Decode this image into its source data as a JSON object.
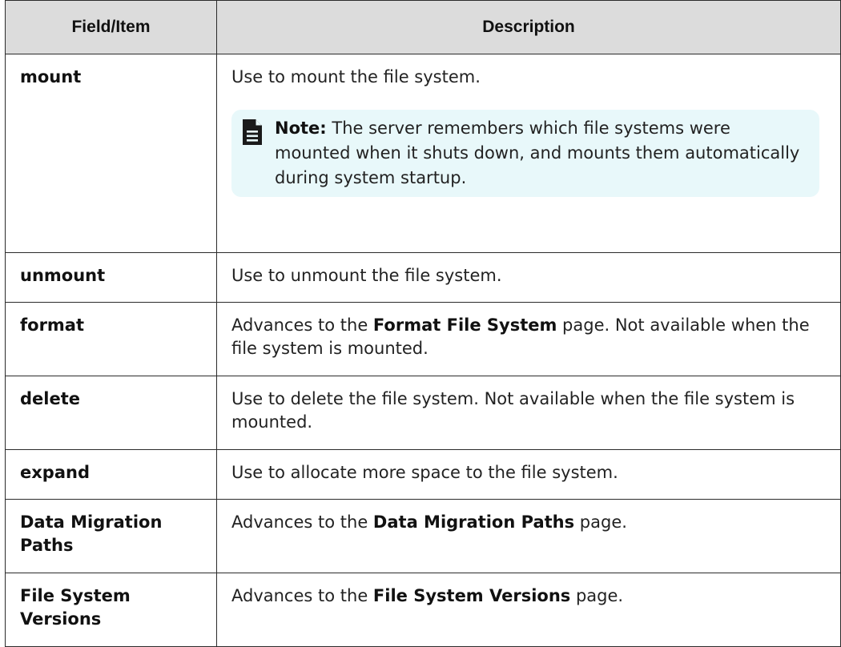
{
  "table": {
    "headers": [
      "Field/Item",
      "Description"
    ],
    "rows": [
      {
        "field": "mount",
        "description": "Use to mount the file system.",
        "note": {
          "icon": "document-note-icon",
          "label": "Note:",
          "text": " The server remembers which file systems were mounted when it shuts down, and mounts them automatically during system startup."
        }
      },
      {
        "field": "unmount",
        "description": "Use to unmount the file system."
      },
      {
        "field": "format",
        "desc_before": "Advances to the ",
        "desc_bold": "Format File System",
        "desc_after": " page. Not available when the file system is mounted."
      },
      {
        "field": "delete",
        "description": "Use to delete the file system. Not available when the file system is mounted."
      },
      {
        "field": "expand",
        "description": "Use to allocate more space to the file system."
      },
      {
        "field": "Data Migration Paths",
        "desc_before": "Advances to the ",
        "desc_bold": "Data Migration Paths",
        "desc_after": " page."
      },
      {
        "field": "File System Versions",
        "desc_before": "Advances to the ",
        "desc_bold": "File System Versions",
        "desc_after": " page."
      }
    ]
  },
  "colors": {
    "header_bg": "#dcdcdc",
    "border": "#2b2b2b",
    "note_bg": "#e8f8fa"
  }
}
